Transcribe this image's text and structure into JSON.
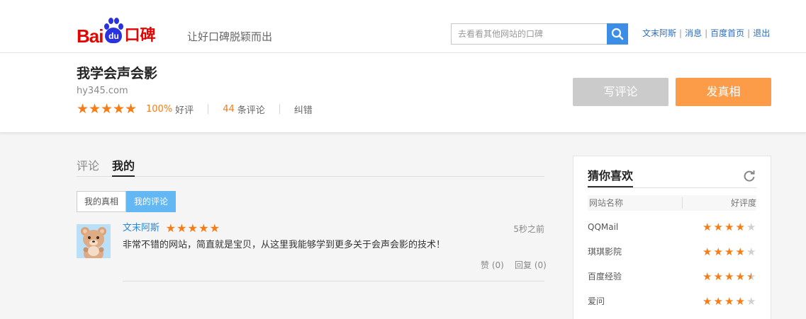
{
  "header": {
    "logo_text": "Bai",
    "logo_paw_text": "du",
    "logo_suffix": "口碑",
    "slogan": "让好口碑脱颖而出",
    "search_placeholder": "去看看其他网站的口碑",
    "links": [
      "文末阿斯",
      "消息",
      "百度首页",
      "退出"
    ]
  },
  "site": {
    "title": "我学会声会影",
    "url": "hy345.com",
    "rating_stars": 5,
    "good_rate": "100%",
    "good_rate_label": "好评",
    "review_count": "44",
    "review_count_label": "条评论",
    "correct_label": "纠错",
    "write_button": "写评论",
    "post_button": "发真相"
  },
  "tabs": [
    "评论",
    "我的"
  ],
  "subtabs": [
    "我的真相",
    "我的评论"
  ],
  "comment": {
    "user": "文末阿斯",
    "stars": 5,
    "time": "5秒之前",
    "text": "非常不错的网站，简直就是宝贝，从这里我能够学到更多关于会声会影的技术！",
    "like": "赞 (0)",
    "reply": "回复 (0)"
  },
  "recommend": {
    "title": "猜你喜欢",
    "col_name": "网站名称",
    "col_rating": "好评度",
    "items": [
      {
        "name": "QQMail",
        "rating": 4
      },
      {
        "name": "琪琪影院",
        "rating": 4
      },
      {
        "name": "百度经验",
        "rating": 4.5
      },
      {
        "name": "爱问",
        "rating": 4
      }
    ]
  },
  "colors": {
    "accent_orange": "#f77c16",
    "post_button": "#fd9c48",
    "search_button": "#3c8de6",
    "link_blue": "#2b6fc2",
    "active_subtab": "#63b7f3"
  }
}
